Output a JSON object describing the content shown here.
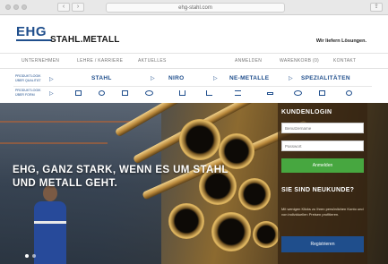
{
  "browser": {
    "url": "ehg-stahl.com",
    "back_icon": "‹",
    "forward_icon": "›",
    "share_icon": "⇪"
  },
  "header": {
    "logo_main": "EHG",
    "logo_sub": "STAHL.METALL",
    "tagline": "Wir liefern Lösungen."
  },
  "topnav": {
    "left": [
      "UNTERNEHMEN",
      "LEHRE / KARRIERE",
      "AKTUELLES"
    ],
    "right": [
      "ANMELDEN",
      "WARENKORB (0)",
      "KONTAKT"
    ]
  },
  "product_rows": {
    "row1_label": "PRODUKTLOGIK ÜBER QUALITÄT",
    "row2_label": "PRODUKTLOGIK ÜBER FORM",
    "categories": [
      "STAHL",
      "NIRO",
      "NE-METALLE",
      "SPEZIALITÄTEN"
    ]
  },
  "hero": {
    "headline": "EHG, GANZ STARK, WENN ES UM STAHL UND METALL GEHT."
  },
  "login": {
    "title": "KUNDENLOGIN",
    "username_placeholder": "Benutzername",
    "password_placeholder": "Passwort",
    "submit_label": "Anmelden",
    "new_title": "SIE SIND NEUKUNDE?",
    "new_text": "Mit wenigen Klicks zu Ihren persönlichen Konto und von individuellen Preisen profitieren.",
    "register_label": "Registrieren"
  },
  "colors": {
    "brand_blue": "#1f4e8c",
    "accent_green": "#47a740"
  }
}
